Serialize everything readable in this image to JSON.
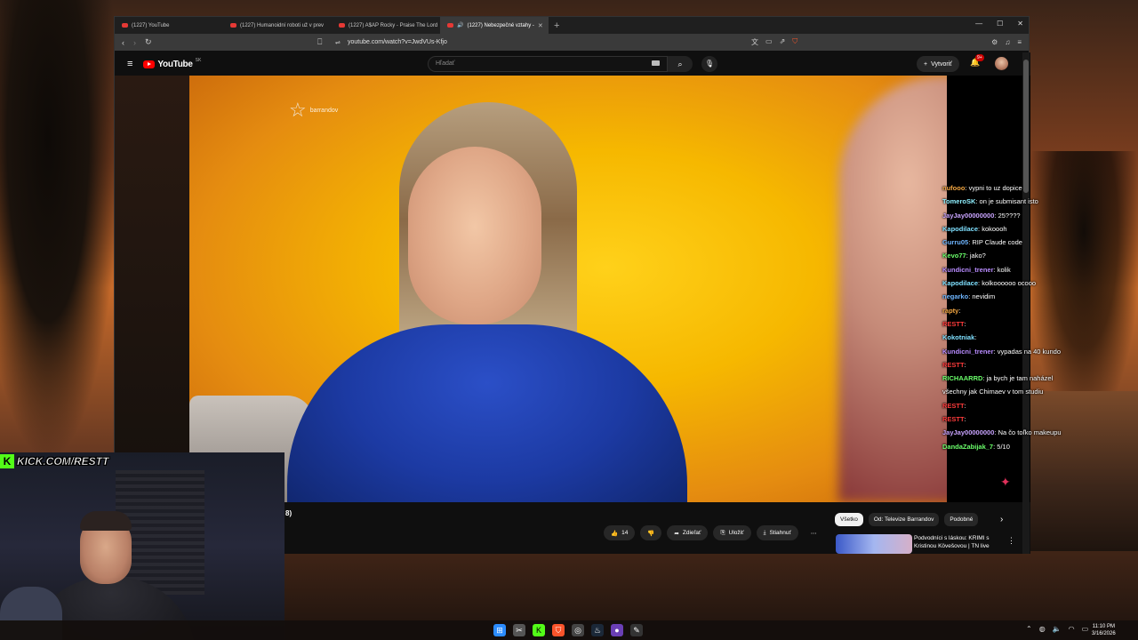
{
  "browser": {
    "tabs": [
      {
        "label": "(1227) YouTube",
        "active": false
      },
      {
        "label": "(1227) Humanoidní roboti už v prev",
        "active": false
      },
      {
        "label": "(1227) A$AP Rocky - Praise The Lord",
        "active": false
      },
      {
        "label": "(1227) Nebezpečné vztahy -",
        "active": true
      }
    ],
    "new_tab": "+",
    "window_controls": [
      "—",
      "☐",
      "✕"
    ],
    "url": "youtube.com/watch?v=JwdVUs-Kfjo"
  },
  "youtube": {
    "logo_text": "YouTube",
    "country": "SK",
    "search_placeholder": "Hľadať",
    "create_label": "Vytvoriť",
    "notif_badge": "9+"
  },
  "video": {
    "channel_watermark": "barrandov"
  },
  "chat": [
    {
      "user": "nufooo",
      "msg": "vypni to uz dopice",
      "color": "#f4a742"
    },
    {
      "user": "TomeroSK",
      "msg": "on je submisant isto",
      "color": "#8ff0ff"
    },
    {
      "user": "JayJay00000000",
      "msg": "25????",
      "color": "#c9a4ff"
    },
    {
      "user": "Kapodilace",
      "msg": "kokoooh",
      "color": "#7fe0ff"
    },
    {
      "user": "Gurru05",
      "msg": "RIP Claude code",
      "color": "#6fb6ff"
    },
    {
      "user": "Kevo77",
      "msg": "jako?",
      "color": "#6bff6b"
    },
    {
      "user": "Kundicni_trener",
      "msg": "kolik",
      "color": "#b98cff"
    },
    {
      "user": "Kapodilace",
      "msg": "kolkoooooo ocooo",
      "color": "#7fe0ff"
    },
    {
      "user": "negarko",
      "msg": "nevidim",
      "color": "#6fb6ff"
    },
    {
      "user": "rapty",
      "msg": "",
      "color": "#f4a742"
    },
    {
      "user": "RESTT",
      "msg": "",
      "color": "#ff3b3b"
    },
    {
      "user": "Kokotniak",
      "msg": "",
      "color": "#7fe0ff"
    },
    {
      "user": "Kundicni_trener",
      "msg": "vypadas na 40 kundo",
      "color": "#b98cff"
    },
    {
      "user": "RESTT",
      "msg": "",
      "color": "#ff3b3b"
    },
    {
      "user": "RICHAARRD",
      "msg": "ja bych je tam naházel",
      "color": "#6bff6b"
    },
    {
      "user": "",
      "msg": "všechny jak Chimaev v tom studiu",
      "color": "#ffffff"
    },
    {
      "user": "RESTT",
      "msg": "",
      "color": "#ff3b3b"
    },
    {
      "user": "RESTT",
      "msg": "",
      "color": "#ff3b3b"
    },
    {
      "user": "JayJay00000000",
      "msg": "Na čo toľko makeupu",
      "color": "#c9a4ff"
    },
    {
      "user": "DandaZabijak_7",
      "msg": "5/10",
      "color": "#6bff6b"
    }
  ],
  "below_video": {
    "title_fragment": "8)",
    "like_count": "14",
    "share_label": "Zdieľať",
    "save_label": "Uložiť",
    "download_label": "Stiahnuť",
    "more": "⋯",
    "chips": [
      "Všetko",
      "Od: Televize Barrandov",
      "Podobné"
    ],
    "recommendation_title": "Podvodníci s láskou: KRIMI s Kristinou Kövešovou | TN live"
  },
  "overlay": {
    "kick_text": "KICK.COM/RESTT",
    "kick_logo": "K"
  },
  "taskbar": {
    "time": "11:10 PM",
    "date": "3/16/2026"
  }
}
